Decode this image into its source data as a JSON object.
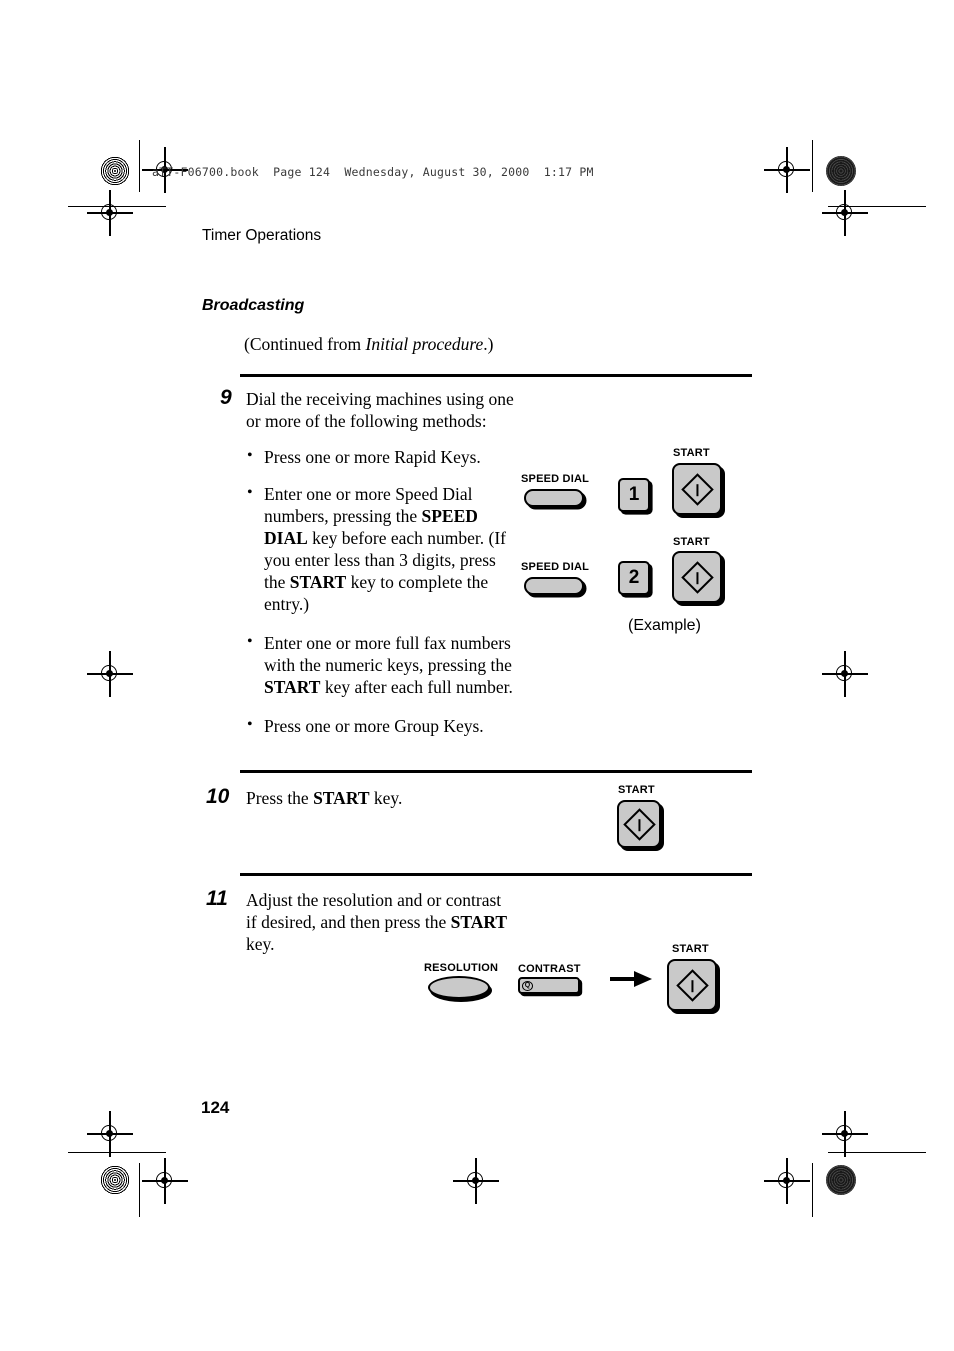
{
  "document": {
    "running_header": "aTT-F06700.book  Page 124  Wednesday, August 30, 2000  1:17 PM",
    "chapter_title": "Timer Operations",
    "section_title": "Broadcasting",
    "continued_from_prefix": "(Continued from ",
    "continued_from_ref": "Initial procedure",
    "continued_from_suffix": ".)",
    "page_number": "124"
  },
  "steps": [
    {
      "number": "9",
      "body_line1": "Dial the receiving machines using one",
      "body_line2": "or more of the following methods:",
      "bullets": [
        {
          "id": "rapid-keys",
          "parts": [
            {
              "text": "Press one or more Rapid Keys.",
              "bold": false
            }
          ]
        },
        {
          "id": "speed-dial",
          "parts": [
            {
              "text": "Enter one or more Speed Dial numbers, pressing the ",
              "bold": false
            },
            {
              "text": "SPEED DIAL",
              "bold": true
            },
            {
              "text": " key before each number. (If you enter less than 3 digits, press the ",
              "bold": false
            },
            {
              "text": "START",
              "bold": true
            },
            {
              "text": " key to complete the entry.)",
              "bold": false
            }
          ]
        },
        {
          "id": "full-fax-numbers",
          "parts": [
            {
              "text": "Enter one or more full fax numbers with the numeric keys, pressing the ",
              "bold": false
            },
            {
              "text": "START",
              "bold": true
            },
            {
              "text": " key after each full number.",
              "bold": false
            }
          ]
        },
        {
          "id": "group-keys",
          "parts": [
            {
              "text": "Press one or more Group Keys.",
              "bold": false
            }
          ]
        }
      ]
    },
    {
      "number": "10",
      "parts": [
        {
          "text": "Press the ",
          "bold": false
        },
        {
          "text": "START",
          "bold": true
        },
        {
          "text": " key.",
          "bold": false
        }
      ]
    },
    {
      "number": "11",
      "parts": [
        {
          "text": "Adjust the resolution and or contrast if desired, and then press the ",
          "bold": false
        },
        {
          "text": "START",
          "bold": true
        },
        {
          "text": " key.",
          "bold": false
        }
      ]
    }
  ],
  "key_art": {
    "speed_dial_label": "SPEED DIAL",
    "start_label": "START",
    "numeric_key_1": "1",
    "numeric_key_2": "2",
    "example_caption": "(Example)",
    "resolution_label": "RESOLUTION",
    "contrast_label": "CONTRAST",
    "contrast_glyph": "Q"
  },
  "colors": {
    "key_face": "#c9c9c9",
    "key_outline": "#000000",
    "page_background": "#ffffff",
    "header_text": "#3a3a3a"
  }
}
